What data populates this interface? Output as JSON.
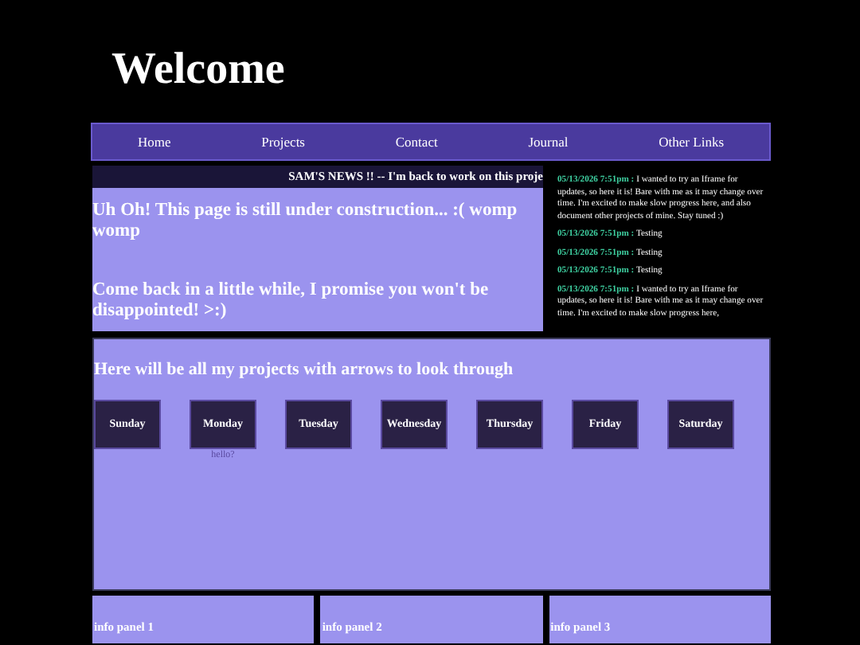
{
  "title": "Welcome",
  "nav": [
    "Home",
    "Projects",
    "Contact",
    "Journal",
    "Other Links"
  ],
  "ticker": "SAM'S NEWS !! -- I'm back to work on this proje",
  "notice": [
    "Uh Oh! This page is still under construction... :( womp womp",
    "Come back in a little while, I promise you won't be disappointed! >:)"
  ],
  "updates": [
    {
      "time": "05/13/2026 7:51pm :",
      "text": "I wanted to try an Iframe for updates, so here it is! Bare with me as it may change over time. I'm excited to make slow progress here, and also document other projects of mine. Stay tuned :)"
    },
    {
      "time": "05/13/2026 7:51pm :",
      "text": "Testing"
    },
    {
      "time": "05/13/2026 7:51pm :",
      "text": "Testing"
    },
    {
      "time": "05/13/2026 7:51pm :",
      "text": "Testing"
    },
    {
      "time": "05/13/2026 7:51pm :",
      "text": "I wanted to try an Iframe for updates, so here it is! Bare with me as it may change over time. I'm excited to make slow progress here,"
    }
  ],
  "projects": {
    "heading": "Here will be all my projects with arrows to look through",
    "days": [
      {
        "label": "Sunday"
      },
      {
        "label": "Monday",
        "note": "hello?"
      },
      {
        "label": "Tuesday"
      },
      {
        "label": "Wednesday"
      },
      {
        "label": "Thursday"
      },
      {
        "label": "Friday"
      },
      {
        "label": "Saturday"
      }
    ]
  },
  "info_panels": [
    "info panel 1",
    "info panel 2",
    "info panel 3"
  ]
}
